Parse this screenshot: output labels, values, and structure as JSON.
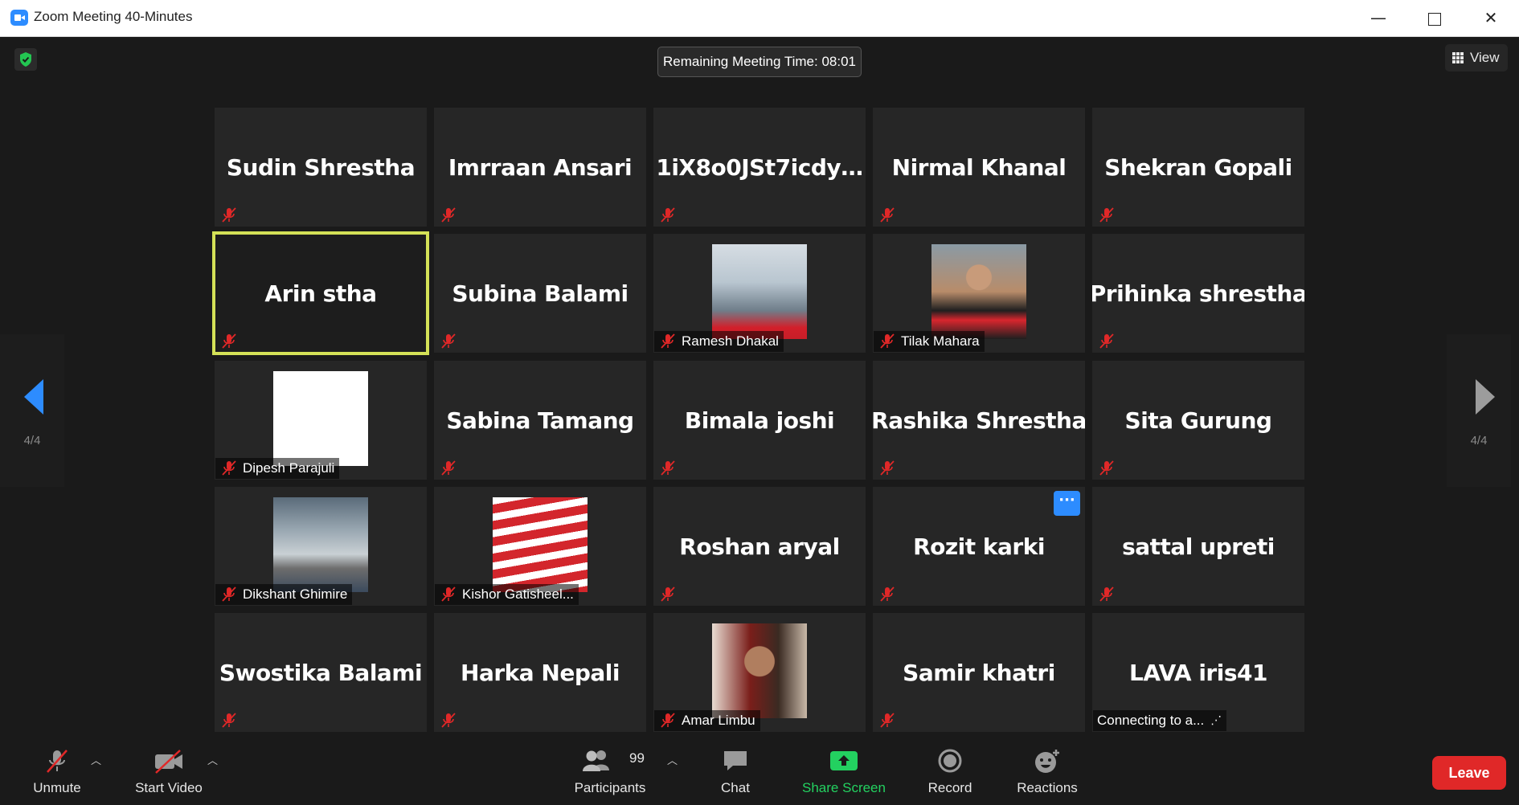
{
  "window": {
    "title": "Zoom Meeting 40-Minutes",
    "minimize": "—",
    "close": "✕"
  },
  "meeting": {
    "remaining_time": "Remaining Meeting Time: 08:01",
    "view_label": "View",
    "page_left": "4/4",
    "page_right": "4/4"
  },
  "colors": {
    "active_border": "#d4e157",
    "brand": "#2d8cff",
    "leave": "#e02828",
    "share": "#23d160"
  },
  "tiles": [
    {
      "name": "Sudin Shrestha",
      "type": "name"
    },
    {
      "name": "Imrraan Ansari",
      "type": "name"
    },
    {
      "name": "1iX8o0JSt7icdy…",
      "type": "name"
    },
    {
      "name": "Nirmal Khanal",
      "type": "name"
    },
    {
      "name": "Shekran Gopali",
      "type": "name"
    },
    {
      "name": "Arin stha",
      "type": "name",
      "active": true
    },
    {
      "name": "Subina Balami",
      "type": "name"
    },
    {
      "name": "Ramesh Dhakal",
      "type": "photo"
    },
    {
      "name": "Tilak Mahara",
      "type": "photo"
    },
    {
      "name": "Prihinka shrestha",
      "type": "name"
    },
    {
      "name": "Dipesh Parajuli",
      "type": "photo"
    },
    {
      "name": "Sabina Tamang",
      "type": "name"
    },
    {
      "name": "Bimala joshi",
      "type": "name"
    },
    {
      "name": "Rashika Shrestha",
      "type": "name"
    },
    {
      "name": "Sita Gurung",
      "type": "name"
    },
    {
      "name": "Dikshant Ghimire",
      "type": "photo"
    },
    {
      "name": "Kishor Gatisheel...",
      "type": "photo"
    },
    {
      "name": "Roshan aryal",
      "type": "name"
    },
    {
      "name": "Rozit karki",
      "type": "name",
      "more": "···"
    },
    {
      "name": "sattal upreti",
      "type": "name"
    },
    {
      "name": "Swostika Balami",
      "type": "name"
    },
    {
      "name": "Harka Nepali",
      "type": "name"
    },
    {
      "name": "Amar Limbu",
      "type": "photo"
    },
    {
      "name": "Samir khatri",
      "type": "name"
    },
    {
      "name": "LAVA iris41",
      "type": "name",
      "status": "Connecting to a..."
    }
  ],
  "toolbar": {
    "unmute": "Unmute",
    "start_video": "Start Video",
    "participants": "Participants",
    "participants_count": "99",
    "chat": "Chat",
    "share_screen": "Share Screen",
    "record": "Record",
    "reactions": "Reactions",
    "leave": "Leave"
  }
}
